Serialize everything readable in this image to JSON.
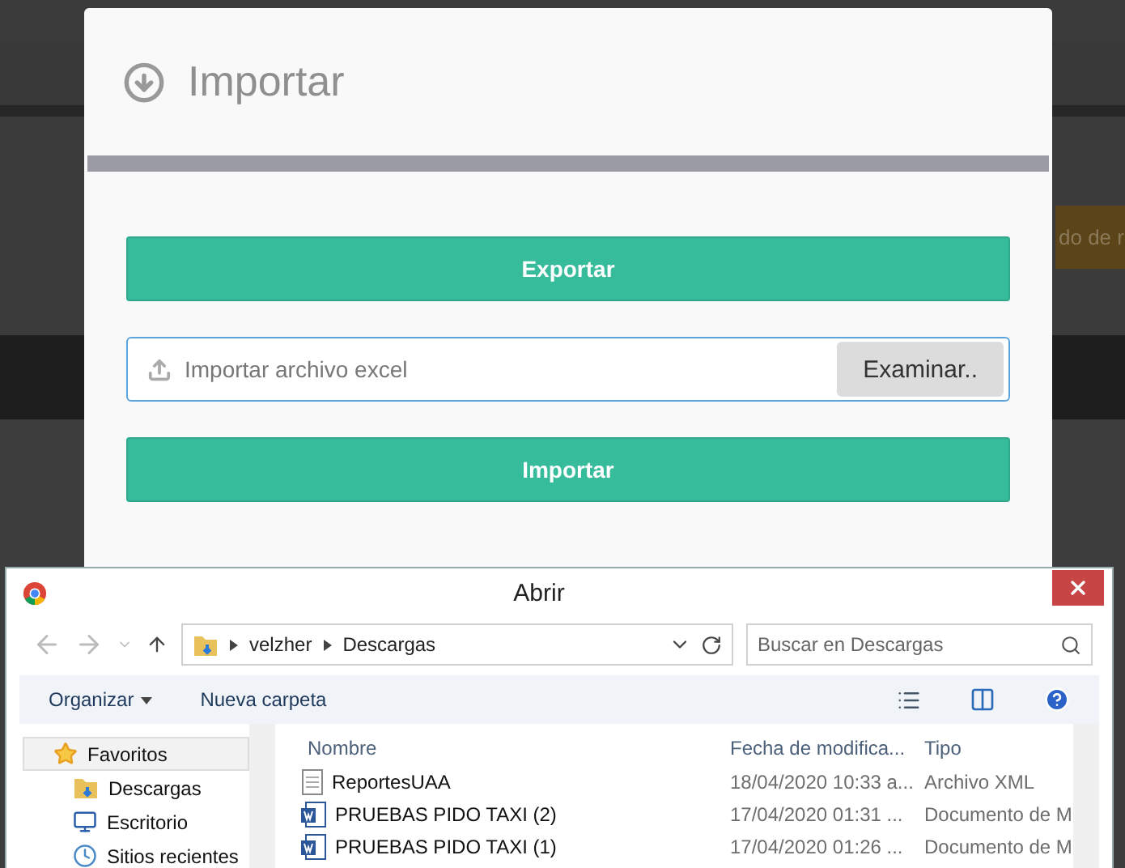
{
  "background": {
    "button": "do de r"
  },
  "modal": {
    "title": "Importar",
    "export_button": "Exportar",
    "file_field": {
      "placeholder": "Importar archivo excel",
      "browse_button": "Examinar.."
    },
    "import_button": "Importar"
  },
  "file_dialog": {
    "title": "Abrir",
    "path": [
      "velzher",
      "Descargas"
    ],
    "search": {
      "placeholder": "Buscar en Descargas"
    },
    "toolbar": {
      "organize": "Organizar",
      "new_folder": "Nueva carpeta"
    },
    "nav": [
      {
        "label": "Favoritos",
        "kind": "star",
        "selected": true
      },
      {
        "label": "Descargas",
        "kind": "downloads",
        "selected": false
      },
      {
        "label": "Escritorio",
        "kind": "desktop",
        "selected": false
      },
      {
        "label": "Sitios recientes",
        "kind": "recent",
        "selected": false
      }
    ],
    "columns": [
      "Nombre",
      "Fecha de modifica...",
      "Tipo"
    ],
    "files": [
      {
        "kind": "xml",
        "name": "ReportesUAA",
        "date": "18/04/2020 10:33 a...",
        "type": "Archivo XML"
      },
      {
        "kind": "word",
        "name": "PRUEBAS PIDO TAXI (2)",
        "date": "17/04/2020 01:31 ...",
        "type": "Documento de M"
      },
      {
        "kind": "word",
        "name": "PRUEBAS PIDO TAXI (1)",
        "date": "17/04/2020 01:26 ...",
        "type": "Documento de M"
      }
    ]
  }
}
